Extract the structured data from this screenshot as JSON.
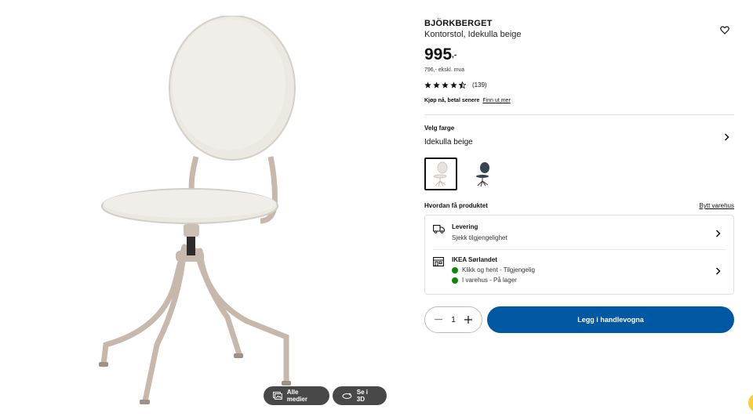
{
  "product": {
    "name": "BJÖRKBERGET",
    "description": "Kontorstol, Idekulla beige",
    "price_main": "995",
    "price_suffix": ",-",
    "price_ex_vat": "796,- ekskl. mva",
    "rating_count": "(139)",
    "rating_stars": 4.5
  },
  "paylater": {
    "text": "Kjøp nå, betal senere",
    "link": "Finn ut mer"
  },
  "color": {
    "label": "Velg farge",
    "value": "Idekulla beige",
    "swatches": [
      {
        "name": "Idekulla beige",
        "selected": true
      },
      {
        "name": "Dark blue",
        "selected": false
      }
    ]
  },
  "delivery": {
    "title": "Hvordan få produktet",
    "change_store": "Bytt varehus",
    "levering_title": "Levering",
    "levering_sub": "Sjekk tilgjengelighet",
    "store_title": "IKEA Sørlandet",
    "store_status_1": "Klikk og hent - Tilgjengelig",
    "store_status_2": "I varehus - På lager",
    "status_color": "#0a8a00"
  },
  "cart": {
    "quantity": "1",
    "add_label": "Legg i handlevogna",
    "accent": "#0058a3"
  },
  "gallery": {
    "media_label": "Alle medier",
    "view3d_label": "Se i 3D"
  }
}
